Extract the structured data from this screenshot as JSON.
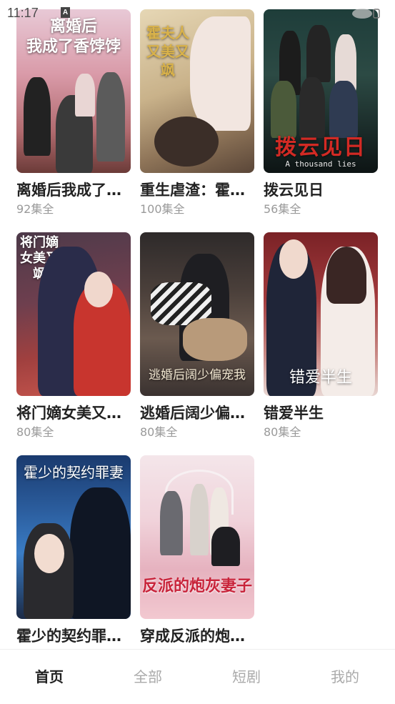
{
  "status": {
    "time": "11:17",
    "a_icon_label": "A"
  },
  "dramas": [
    {
      "title": "离婚后我成了…",
      "episodes": "92集全",
      "poster_text": "离婚后\n我成了香饽饽"
    },
    {
      "title": "重生虐渣：霍…",
      "episodes": "100集全",
      "poster_text": "霍夫人又美又飒"
    },
    {
      "title": "拨云见日",
      "episodes": "56集全",
      "poster_text": "拨云见日",
      "poster_subtext": "A thousand lies"
    },
    {
      "title": "将门嫡女美又…",
      "episodes": "80集全",
      "poster_text": "将门嫡女美又飒"
    },
    {
      "title": "逃婚后阔少偏…",
      "episodes": "80集全",
      "poster_text": "逃婚后阔少偏宠我"
    },
    {
      "title": "错爱半生",
      "episodes": "80集全",
      "poster_text": "错爱半生"
    },
    {
      "title": "霍少的契约罪…",
      "episodes": "",
      "poster_text": "霍少的契约罪妻"
    },
    {
      "title": "穿成反派的炮…",
      "episodes": "",
      "poster_text": "反派的炮灰妻子"
    }
  ],
  "bottom_nav": [
    {
      "label": "首页",
      "active": true
    },
    {
      "label": "全部",
      "active": false
    },
    {
      "label": "短剧",
      "active": false
    },
    {
      "label": "我的",
      "active": false
    }
  ]
}
